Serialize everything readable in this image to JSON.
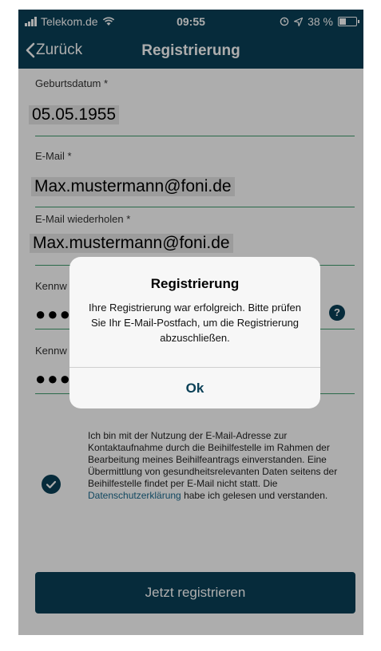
{
  "status_bar": {
    "carrier": "Telekom.de",
    "time": "09:55",
    "battery": "38 %",
    "battery_level": 0.38
  },
  "nav": {
    "back_label": "Zurück",
    "title": "Registrierung"
  },
  "form": {
    "birthdate": {
      "label": "Geburtsdatum",
      "required": "*",
      "value": "05.05.1955"
    },
    "email": {
      "label": "E-Mail",
      "required": "*",
      "value": "Max.mustermann@foni.de"
    },
    "email_repeat": {
      "label": "E-Mail wiederholen",
      "required": "*",
      "value": "Max.mustermann@foni.de"
    },
    "password": {
      "label": "Kennw",
      "value": "●●●"
    },
    "password_repeat": {
      "label": "Kennw",
      "value": "●●●"
    },
    "help_icon": "?"
  },
  "consent": {
    "text": "Ich bin mit der Nutzung der E-Mail-Adresse zur Kontaktaufnahme durch die Beihilfestelle im Rahmen der Bearbeitung meines Beihilfeantrags einverstanden. Eine Übermittlung von gesundheitsrelevanten Daten seitens der Beihilfestelle findet per E-Mail nicht statt. Die",
    "link": "Datenschutzerklärung",
    "suffix": "habe ich gelesen und verstanden.",
    "checked": true
  },
  "register_button": "Jetzt registrieren",
  "alert": {
    "title": "Registrierung",
    "message": "Ihre Registrierung war erfolgreich. Bitte prüfen Sie Ihr E-Mail-Postfach, um die Registrierung abzuschließen.",
    "button": "Ok"
  },
  "colors": {
    "primary": "#0a4057",
    "field_underline": "#3f9d6e",
    "link": "#1b6b8f"
  },
  "icons": [
    "signal-bars-icon",
    "wifi-icon",
    "alarm-icon",
    "location-arrow-icon",
    "battery-icon",
    "chevron-left-icon",
    "help-icon",
    "checkmark-icon"
  ]
}
